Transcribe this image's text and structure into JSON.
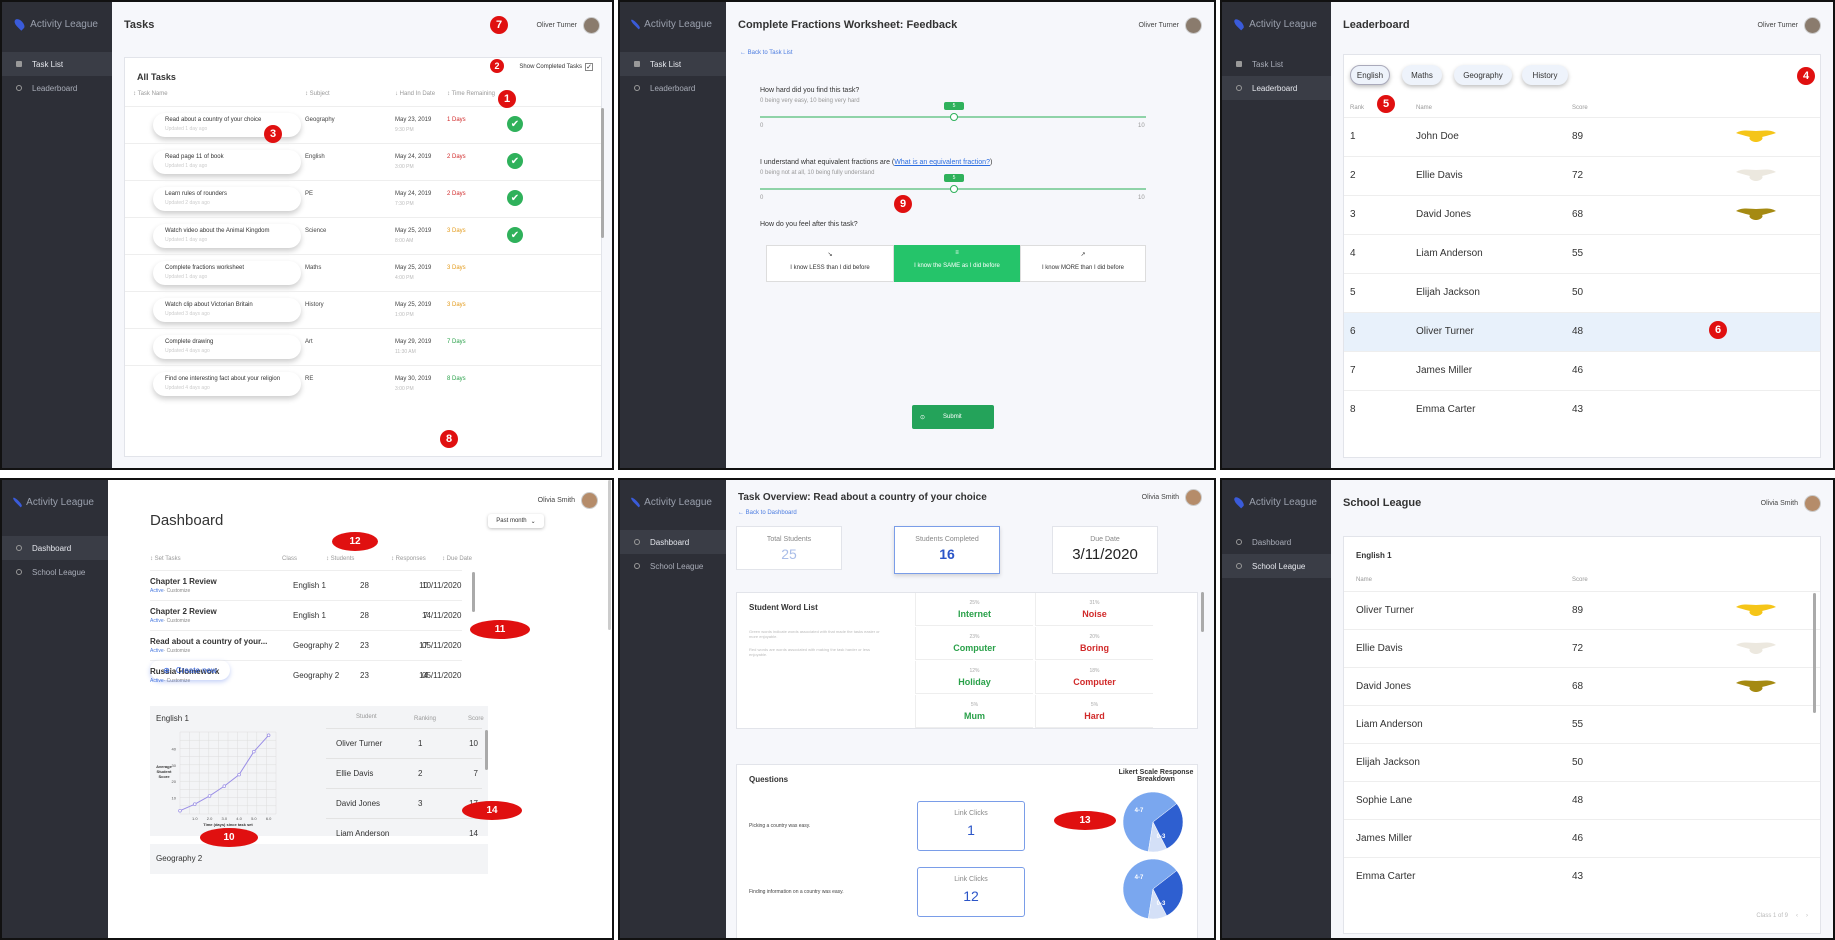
{
  "brand": "Activity League",
  "p1": {
    "title": "Tasks",
    "user": "Oliver Turner",
    "nav": [
      "Task List",
      "Leaderboard"
    ],
    "card_title": "All Tasks",
    "show_completed": "Show Completed Tasks",
    "headers": [
      "Task Name",
      "Subject",
      "Hand In Date",
      "Time Remaining"
    ],
    "rows": [
      {
        "name": "Read about a country of your choice",
        "sub": "Updated 1 day ago",
        "subject": "Geography",
        "date": "May 23, 2019",
        "time": "9:30 PM",
        "remaining": "1 Days",
        "done": true,
        "color": "#d12a2a"
      },
      {
        "name": "Read page 11 of book",
        "sub": "Updated 1 day ago",
        "subject": "English",
        "date": "May 24, 2019",
        "time": "3:00 PM",
        "remaining": "2 Days",
        "done": true,
        "color": "#d12a2a"
      },
      {
        "name": "Learn rules of rounders",
        "sub": "Updated 2 days ago",
        "subject": "PE",
        "date": "May 24, 2019",
        "time": "7:30 PM",
        "remaining": "2 Days",
        "done": true,
        "color": "#d12a2a"
      },
      {
        "name": "Watch video about the Animal Kingdom",
        "sub": "Updated 1 day ago",
        "subject": "Science",
        "date": "May 25, 2019",
        "time": "8:00 AM",
        "remaining": "3 Days",
        "done": true,
        "color": "#e39a1a"
      },
      {
        "name": "Complete fractions worksheet",
        "sub": "Updated 1 day ago",
        "subject": "Maths",
        "date": "May 25, 2019",
        "time": "4:00 PM",
        "remaining": "3 Days",
        "done": false,
        "color": "#e39a1a"
      },
      {
        "name": "Watch clip about Victorian Britain",
        "sub": "Updated 3 days ago",
        "subject": "History",
        "date": "May 25, 2019",
        "time": "1:00 PM",
        "remaining": "3 Days",
        "done": false,
        "color": "#e39a1a"
      },
      {
        "name": "Complete drawing",
        "sub": "Updated 4 days ago",
        "subject": "Art",
        "date": "May 29, 2019",
        "time": "11:30 AM",
        "remaining": "7 Days",
        "done": false,
        "color": "#2aa14a"
      },
      {
        "name": "Find one interesting fact about your religion",
        "sub": "Updated 4 days ago",
        "subject": "RE",
        "date": "May 30, 2019",
        "time": "3:00 PM",
        "remaining": "8 Days",
        "done": false,
        "color": "#2aa14a"
      }
    ],
    "markers": [
      "1",
      "2",
      "3",
      "7",
      "8"
    ]
  },
  "p2": {
    "title": "Complete Fractions Worksheet: Feedback",
    "user": "Oliver Turner",
    "nav": [
      "Task List",
      "Leaderboard"
    ],
    "back": "Back to Task List",
    "q1": "How hard did you find this task?",
    "q1_sub": "0 being very easy, 10 being very hard",
    "q1_value": "5",
    "q2_pre": "I understand what equivalent fractions are (",
    "q2_link": "What is an equivalent fraction?",
    "q2_post": ")",
    "q2_sub": "0 being not at all, 10 being fully understand",
    "q2_value": "5",
    "min": "0",
    "max": "10",
    "q3": "How do you feel after this task?",
    "opts": [
      "I know LESS than I did before",
      "I know the SAME as I did before",
      "I know MORE than I did before"
    ],
    "submit": "Submit",
    "marker": "9"
  },
  "p3": {
    "title": "Leaderboard",
    "user": "Oliver Turner",
    "nav": [
      "Task List",
      "Leaderboard"
    ],
    "tabs": [
      "English",
      "Maths",
      "Geography",
      "History"
    ],
    "headers": [
      "Rank",
      "Name",
      "Score"
    ],
    "rows": [
      {
        "rank": "1",
        "name": "John Doe",
        "score": "89",
        "medal": "#f5c518"
      },
      {
        "rank": "2",
        "name": "Ellie Davis",
        "score": "72",
        "medal": "#ece8df"
      },
      {
        "rank": "3",
        "name": "David Jones",
        "score": "68",
        "medal": "#a58a12"
      },
      {
        "rank": "4",
        "name": "Liam Anderson",
        "score": "55",
        "medal": ""
      },
      {
        "rank": "5",
        "name": "Elijah Jackson",
        "score": "50",
        "medal": ""
      },
      {
        "rank": "6",
        "name": "Oliver Turner",
        "score": "48",
        "medal": ""
      },
      {
        "rank": "7",
        "name": "James Miller",
        "score": "46",
        "medal": ""
      },
      {
        "rank": "8",
        "name": "Emma Carter",
        "score": "43",
        "medal": ""
      }
    ],
    "markers": [
      "4",
      "5",
      "6"
    ]
  },
  "p4": {
    "title": "Dashboard",
    "user": "Olivia Smith",
    "nav": [
      "Dashboard",
      "School League"
    ],
    "period": "Past month",
    "headers": [
      "Set Tasks",
      "Class",
      "Students",
      "Responses",
      "Due Date"
    ],
    "rows": [
      {
        "name": "Chapter 1 Review",
        "status": "Active",
        "action": "· Customize",
        "class": "English 1",
        "students": "28",
        "responses": "10",
        "due": "10/11/2020"
      },
      {
        "name": "Chapter 2 Review",
        "status": "Active",
        "action": "· Customize",
        "class": "English 1",
        "students": "28",
        "responses": "7",
        "due": "14/11/2020"
      },
      {
        "name": "Read about a country of your...",
        "status": "Active",
        "action": "· Customize",
        "class": "Geography 2",
        "students": "23",
        "responses": "17",
        "due": "05/11/2020"
      },
      {
        "name": "Russia Homework",
        "status": "Active",
        "action": "· Customize",
        "class": "Geography 2",
        "students": "23",
        "responses": "14",
        "due": "05/11/2020"
      }
    ],
    "create": "Create new",
    "class_title": "English 1",
    "rank_headers": [
      "Student",
      "Ranking",
      "Score"
    ],
    "rank_rows": [
      {
        "name": "Oliver Turner",
        "rank": "1",
        "score": "10"
      },
      {
        "name": "Ellie Davis",
        "rank": "2",
        "score": "7"
      },
      {
        "name": "David Jones",
        "rank": "3",
        "score": "17"
      },
      {
        "name": "Liam Anderson",
        "rank": "",
        "score": "14"
      }
    ],
    "next_class": "Geography 2",
    "markers": [
      "10",
      "11",
      "12",
      "14"
    ],
    "chart_data": {
      "type": "line",
      "x": [
        0,
        1,
        2,
        3,
        4,
        5,
        6
      ],
      "y": [
        2,
        6,
        11,
        17,
        24,
        38,
        48
      ],
      "xticks": [
        "1.0",
        "2.0",
        "3.0",
        "4.0",
        "5.0",
        "6.0"
      ],
      "yticks": [
        "10",
        "20",
        "30",
        "40"
      ],
      "ylabel": "Average Student Score",
      "xlabel": "Time (days) since task set",
      "xlim": [
        0,
        6.5
      ],
      "ylim": [
        0,
        50
      ],
      "grid": true,
      "color": "#9a8ee6"
    }
  },
  "p5": {
    "title": "Task Overview: Read about a country of your choice",
    "user": "Olivia Smith",
    "nav": [
      "Dashboard",
      "School League"
    ],
    "back": "Back to Dashboard",
    "stats": [
      {
        "label": "Total Students",
        "value": "25"
      },
      {
        "label": "Students Completed",
        "value": "16"
      },
      {
        "label": "Due Date",
        "value": "3/11/2020"
      }
    ],
    "word_title": "Student Word List",
    "word_note1": "Green words indicate words associated with that made the tasks easier or more enjoyable.",
    "word_note2": "Red words are words associated with making the task harder or less enjoyable.",
    "good": [
      {
        "pct": "25%",
        "word": "Internet"
      },
      {
        "pct": "23%",
        "word": "Computer"
      },
      {
        "pct": "12%",
        "word": "Holiday"
      },
      {
        "pct": "5%",
        "word": "Mum"
      }
    ],
    "bad": [
      {
        "pct": "31%",
        "word": "Noise"
      },
      {
        "pct": "20%",
        "word": "Boring"
      },
      {
        "pct": "18%",
        "word": "Computer"
      },
      {
        "pct": "5%",
        "word": "Hard"
      }
    ],
    "questions": "Questions",
    "likert": "Likert Scale Response Breakdown",
    "q": [
      {
        "text": "Picking a country was easy.",
        "label": "Link Clicks",
        "value": "1",
        "a": "4-7",
        "b": "0-3"
      },
      {
        "text": "Finding information on a country was easy.",
        "label": "Link Clicks",
        "value": "12",
        "a": "4-7",
        "b": "0-3"
      }
    ],
    "marker": "13",
    "pie_data": {
      "type": "pie",
      "slices": [
        {
          "label": "0-3",
          "value": 0.62,
          "color": "#7aa7ef"
        },
        {
          "label": "4-7",
          "value": 0.28,
          "color": "#2e5fd0"
        },
        {
          "label": "8-10",
          "value": 0.1,
          "color": "#d4e0f7"
        }
      ]
    }
  },
  "p6": {
    "title": "School League",
    "user": "Olivia Smith",
    "nav": [
      "Dashboard",
      "School League"
    ],
    "card_title": "English 1",
    "headers": [
      "Name",
      "Score"
    ],
    "rows": [
      {
        "name": "Oliver Turner",
        "score": "89",
        "medal": "#f5c518"
      },
      {
        "name": "Ellie Davis",
        "score": "72",
        "medal": "#ece8df"
      },
      {
        "name": "David Jones",
        "score": "68",
        "medal": "#a58a12"
      },
      {
        "name": "Liam Anderson",
        "score": "55",
        "medal": ""
      },
      {
        "name": "Elijah Jackson",
        "score": "50",
        "medal": ""
      },
      {
        "name": "Sophie Lane",
        "score": "48",
        "medal": ""
      },
      {
        "name": "James Miller",
        "score": "46",
        "medal": ""
      },
      {
        "name": "Emma Carter",
        "score": "43",
        "medal": ""
      }
    ],
    "pager": "Class 1 of 9"
  }
}
